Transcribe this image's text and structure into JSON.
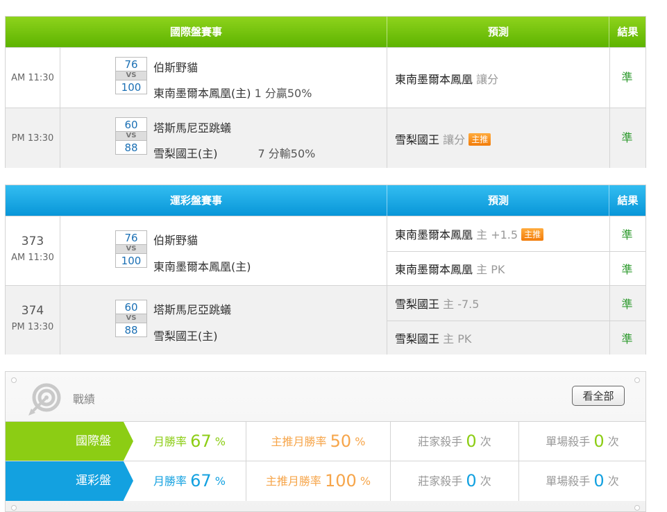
{
  "intl": {
    "header": {
      "title": "國際盤賽事",
      "prediction": "預測",
      "result": "結果"
    },
    "matches": [
      {
        "time": "AM 11:30",
        "away_score": "76",
        "vs": "VS",
        "home_score": "100",
        "away_team": "伯斯野貓",
        "home_team": "東南墨爾本鳳凰(主)",
        "handicap": "1 分贏50%",
        "pred_team": "東南墨爾本鳳凰",
        "pred_type": "讓分",
        "tag": "",
        "result": "準"
      },
      {
        "time": "PM 13:30",
        "away_score": "60",
        "vs": "VS",
        "home_score": "88",
        "away_team": "塔斯馬尼亞跳蟻",
        "home_team": "雪梨國王(主)",
        "handicap": "7 分輸50%",
        "pred_team": "雪梨國王",
        "pred_type": "讓分",
        "tag": "主推",
        "result": "準"
      }
    ]
  },
  "lottery": {
    "header": {
      "title": "運彩盤賽事",
      "prediction": "預測",
      "result": "結果"
    },
    "matches": [
      {
        "num": "373",
        "time": "AM 11:30",
        "away_score": "76",
        "vs": "VS",
        "home_score": "100",
        "away_team": "伯斯野貓",
        "home_team": "東南墨爾本鳳凰(主)",
        "preds": [
          {
            "team": "東南墨爾本鳳凰",
            "detail": "主 +1.5",
            "tag": "主推",
            "result": "準"
          },
          {
            "team": "東南墨爾本鳳凰",
            "detail": "主 PK",
            "tag": "",
            "result": "準"
          }
        ]
      },
      {
        "num": "374",
        "time": "PM 13:30",
        "away_score": "60",
        "vs": "VS",
        "home_score": "88",
        "away_team": "塔斯馬尼亞跳蟻",
        "home_team": "雪梨國王(主)",
        "preds": [
          {
            "team": "雪梨國王",
            "detail": "主 -7.5",
            "tag": "",
            "result": "準"
          },
          {
            "team": "雪梨國王",
            "detail": "主 PK",
            "tag": "",
            "result": "準"
          }
        ]
      }
    ]
  },
  "record": {
    "title": "戰績",
    "view_all": "看全部",
    "icon": "target-icon",
    "rows": [
      {
        "label": "國際盤",
        "monthly_label": "月勝率",
        "monthly": "67",
        "unit": "%",
        "main_label": "主推月勝率",
        "main": "50",
        "killer_label": "莊家殺手",
        "killer": "0",
        "times": "次",
        "single_label": "單場殺手",
        "single": "0"
      },
      {
        "label": "運彩盤",
        "monthly_label": "月勝率",
        "monthly": "67",
        "unit": "%",
        "main_label": "主推月勝率",
        "main": "100",
        "killer_label": "莊家殺手",
        "killer": "0",
        "times": "次",
        "single_label": "單場殺手",
        "single": "0"
      }
    ]
  },
  "colors": {
    "green_header": "#5db300",
    "blue_header": "#0896d8",
    "tag_orange": "#f27c0a",
    "result_green": "#2e9a2e"
  }
}
